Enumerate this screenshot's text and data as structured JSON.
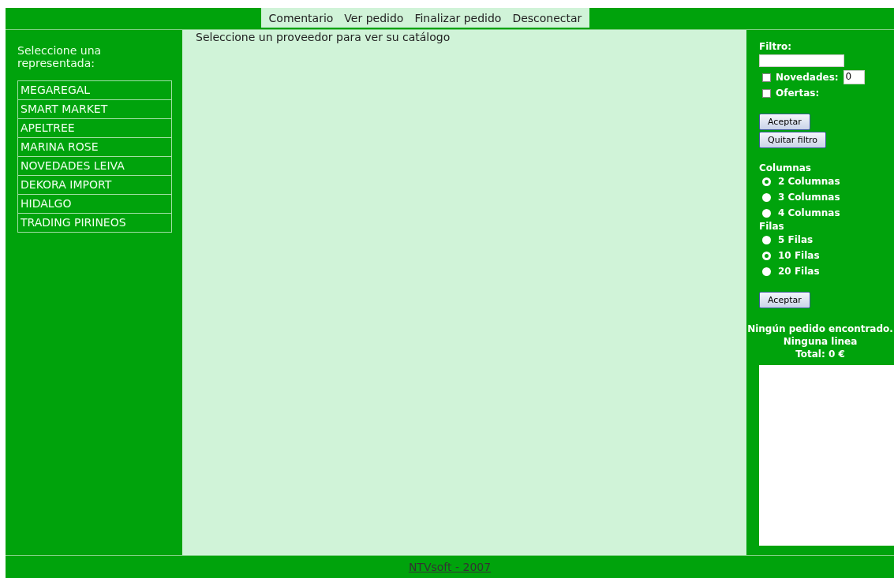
{
  "top_menu": [
    {
      "label": "Comentario"
    },
    {
      "label": "Ver pedido"
    },
    {
      "label": "Finalizar pedido"
    },
    {
      "label": "Desconectar"
    }
  ],
  "sidebar": {
    "heading": "Seleccione una representada:",
    "items": [
      {
        "label": "MEGAREGAL"
      },
      {
        "label": "SMART MARKET"
      },
      {
        "label": "APELTREE"
      },
      {
        "label": "MARINA ROSE"
      },
      {
        "label": "NOVEDADES LEIVA"
      },
      {
        "label": "DEKORA IMPORT"
      },
      {
        "label": "HIDALGO"
      },
      {
        "label": "TRADING PIRINEOS"
      }
    ]
  },
  "main": {
    "message": "Seleccione un proveedor para ver su catálogo"
  },
  "filter": {
    "label": "Filtro:",
    "novedades": {
      "label": "Novedades:",
      "checked": false,
      "value": "0"
    },
    "ofertas": {
      "label": "Ofertas:",
      "checked": false
    },
    "accept": "Aceptar",
    "clear": "Quitar filtro"
  },
  "layout": {
    "columns_label": "Columnas",
    "columns": [
      {
        "label": "2 Columnas",
        "selected": true
      },
      {
        "label": "3 Columnas",
        "selected": false
      },
      {
        "label": "4 Columnas",
        "selected": false
      }
    ],
    "rows_label": "Filas",
    "rows": [
      {
        "label": "5 Filas",
        "selected": false
      },
      {
        "label": "10 Filas",
        "selected": true
      },
      {
        "label": "20 Filas",
        "selected": false
      }
    ],
    "accept": "Aceptar"
  },
  "order": {
    "lines": [
      "Ningún pedido encontrado.",
      "Ninguna linea",
      "Total: 0 €"
    ]
  },
  "footer": {
    "link": "NTVsoft - 2007"
  }
}
